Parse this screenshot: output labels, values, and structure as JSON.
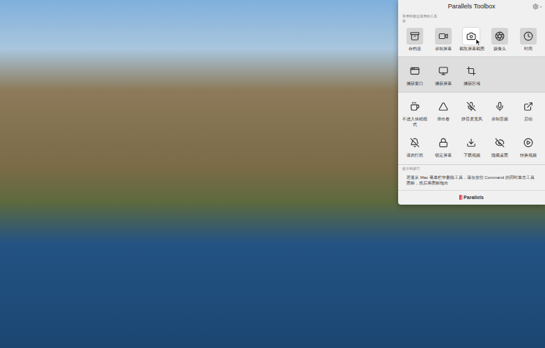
{
  "window": {
    "title": "Parallels Toolbox"
  },
  "favorites_caption": "常用和最近使用的工具",
  "library_caption": "库",
  "top_tools": [
    {
      "label": "存档器",
      "selected": false
    },
    {
      "label": "录制屏幕",
      "selected": false
    },
    {
      "label": "截取屏幕截图",
      "selected": true
    },
    {
      "label": "摄像头",
      "selected": false
    },
    {
      "label": "时间",
      "selected": false
    }
  ],
  "submenu": {
    "expanded": true,
    "items": [
      {
        "label": "捕获窗口"
      },
      {
        "label": "捕获屏幕"
      },
      {
        "label": "捕获区域"
      }
    ]
  },
  "tool_rows": [
    [
      {
        "label": "不进入休眠模式"
      },
      {
        "label": "弹出卷"
      },
      {
        "label": "静音麦克风"
      },
      {
        "label": "录制音频"
      },
      {
        "label": "启动"
      }
    ],
    [
      {
        "label": "请勿打扰"
      },
      {
        "label": "锁定屏幕"
      },
      {
        "label": "下载视频"
      },
      {
        "label": "隐藏桌面"
      },
      {
        "label": "转换视频"
      }
    ]
  ],
  "tips": {
    "title": "提示和技巧",
    "text": "若要从 Mac 菜单栏中删除工具，请在按住 Command 的同时单击工具图标，然后将图标拖出"
  },
  "footer": {
    "logo": "Parallels"
  }
}
